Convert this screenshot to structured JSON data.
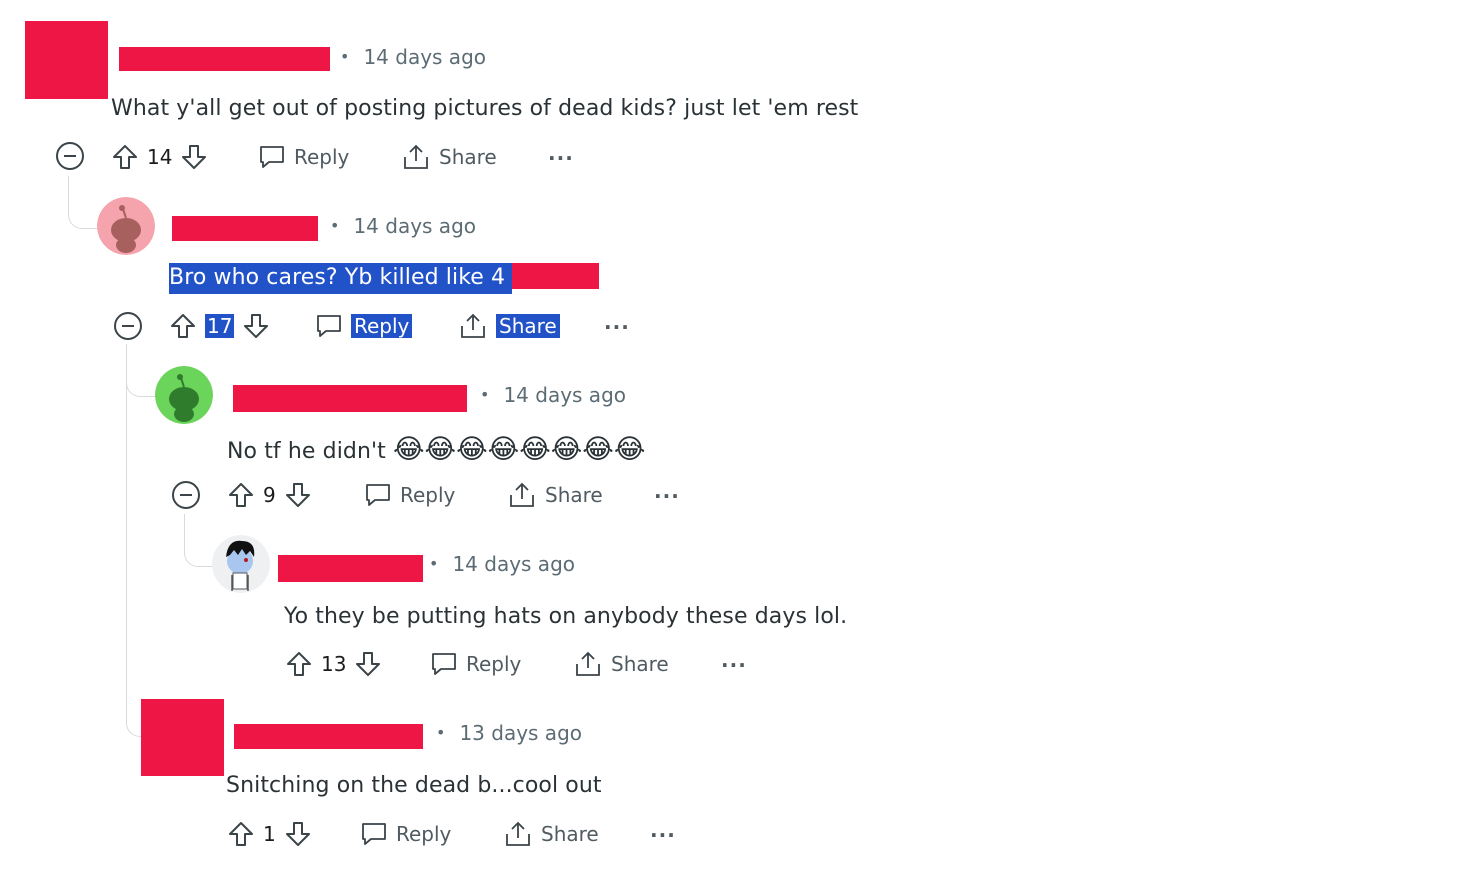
{
  "colors": {
    "redaction": "#ee1645",
    "selection": "#2252c8",
    "meta": "#5c6c74",
    "thread": "#d8dbdd"
  },
  "labels": {
    "reply": "Reply",
    "share": "Share",
    "more": "···"
  },
  "comments": [
    {
      "time": "14 days ago",
      "text": "What y'all get out of posting pictures of dead kids? just let 'em rest",
      "votes": "14"
    },
    {
      "time": "14 days ago",
      "text": "Bro who cares? Yb killed like 4",
      "votes": "17"
    },
    {
      "time": "14 days ago",
      "text": "No tf he didn't",
      "emoji": "😂😂😂😂😂😂😂😂",
      "votes": "9"
    },
    {
      "time": "14 days ago",
      "text": "Yo they be putting hats on anybody these days lol.",
      "votes": "13"
    },
    {
      "time": "13 days ago",
      "text": "Snitching on the dead b...cool out",
      "votes": "1"
    }
  ],
  "icons": {
    "collapse": "collapse-icon",
    "upvote": "upvote-icon",
    "downvote": "downvote-icon",
    "reply": "comment-bubble-icon",
    "share": "share-icon",
    "more": "more-icon"
  }
}
